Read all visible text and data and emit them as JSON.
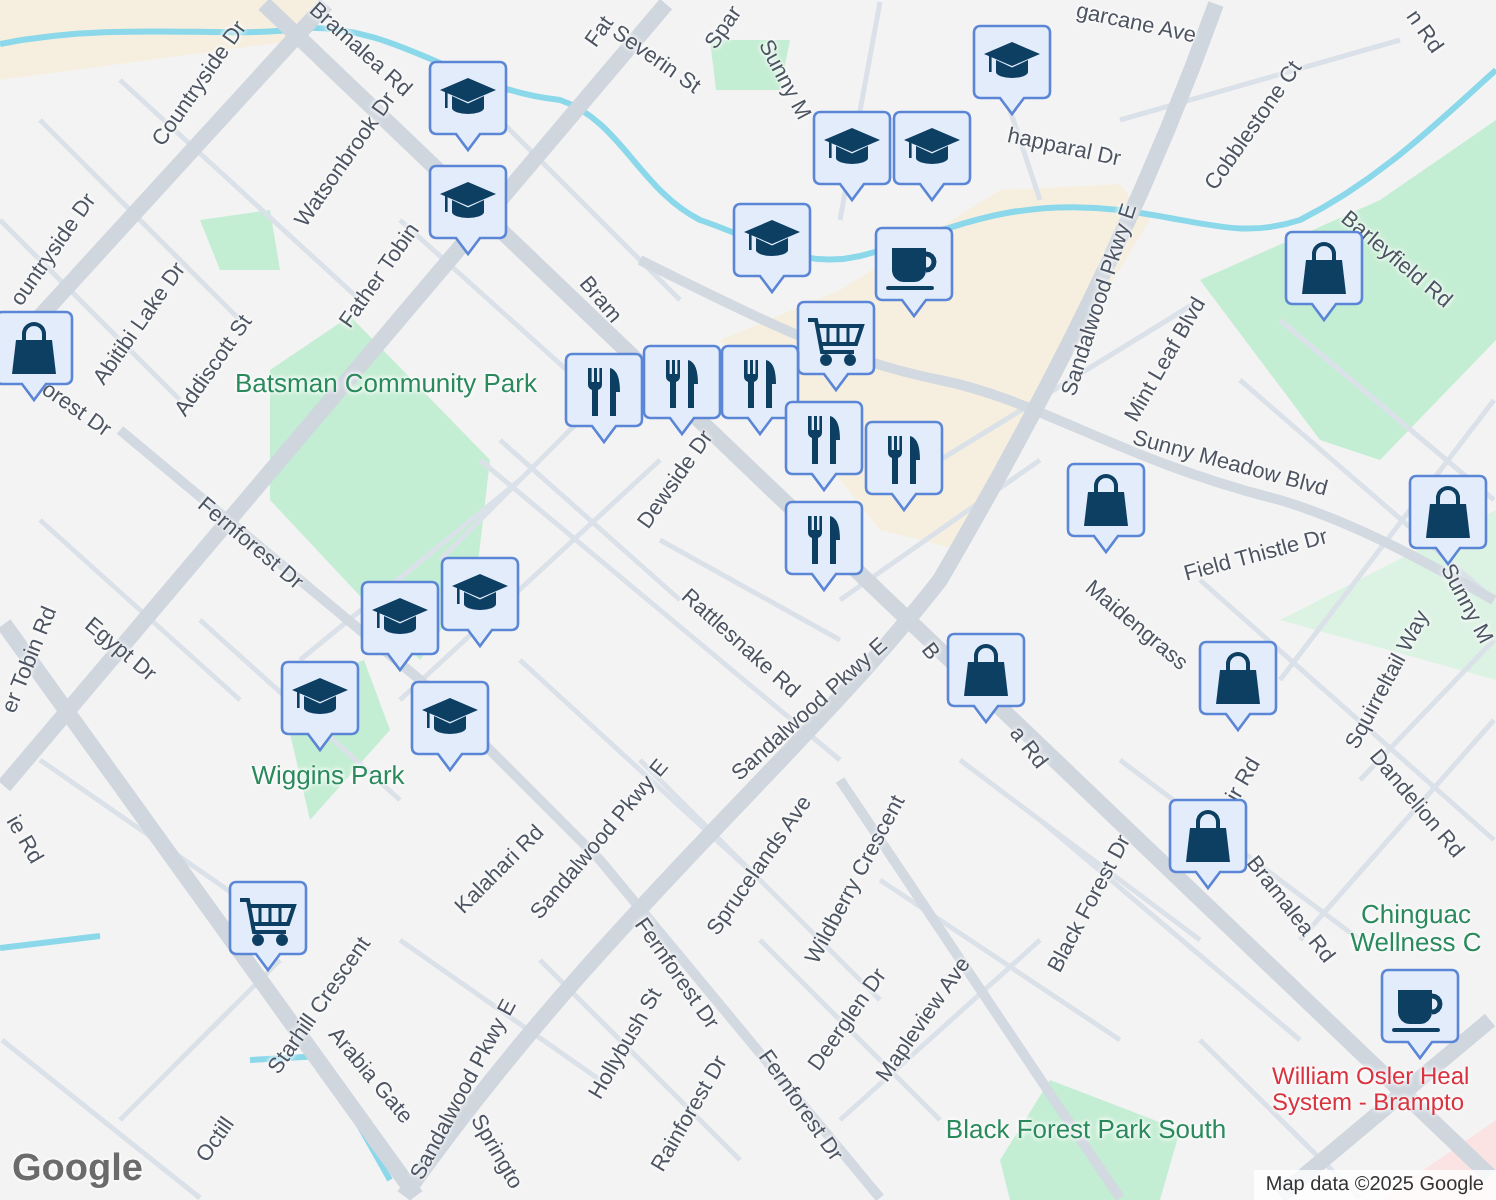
{
  "labels": [
    {
      "text": "Countryside Dr",
      "kind": "road"
    },
    {
      "text": "Bramalea Rd",
      "kind": "road"
    },
    {
      "text": "Fat",
      "kind": "road"
    },
    {
      "text": "Severin St",
      "kind": "road"
    },
    {
      "text": "Spar",
      "kind": "road"
    },
    {
      "text": "garcane Ave",
      "kind": "road"
    },
    {
      "text": "n Rd",
      "kind": "road"
    },
    {
      "text": "Sunny M",
      "kind": "road"
    },
    {
      "text": "happaral Dr",
      "kind": "road"
    },
    {
      "text": "Cobblestone Ct",
      "kind": "road"
    },
    {
      "text": "Sandalwood Pkwy E",
      "kind": "road"
    },
    {
      "text": "Barleyfield Rd",
      "kind": "road"
    },
    {
      "text": "Mint Leaf Blvd",
      "kind": "road"
    },
    {
      "text": "Sunny Meadow Blvd",
      "kind": "road"
    },
    {
      "text": "Field Thistle Dr",
      "kind": "road"
    },
    {
      "text": "Sunny M",
      "kind": "road"
    },
    {
      "text": "Watsonbrook Dr",
      "kind": "road"
    },
    {
      "text": "Abitibi Lake Dr",
      "kind": "road"
    },
    {
      "text": "Addiscott St",
      "kind": "road"
    },
    {
      "text": "Father Tobin",
      "kind": "road"
    },
    {
      "text": "ountryside Dr",
      "kind": "road"
    },
    {
      "text": "orest Dr",
      "kind": "road"
    },
    {
      "text": "Bram",
      "kind": "road"
    },
    {
      "text": "Batsman Community Park",
      "kind": "park"
    },
    {
      "text": "Dewside Dr",
      "kind": "road"
    },
    {
      "text": "Fernforest Dr",
      "kind": "road"
    },
    {
      "text": "Rattlesnake Rd",
      "kind": "road"
    },
    {
      "text": "Egypt Dr",
      "kind": "road"
    },
    {
      "text": "er Tobin Rd",
      "kind": "road"
    },
    {
      "text": "Wiggins Park",
      "kind": "park"
    },
    {
      "text": "Kalahari Rd",
      "kind": "road"
    },
    {
      "text": "ie Rd",
      "kind": "road"
    },
    {
      "text": "Sandalwood Pkwy E",
      "kind": "road"
    },
    {
      "text": "Sandalwood Pkwy E",
      "kind": "road"
    },
    {
      "text": "Sandalwood Pkwy E",
      "kind": "road"
    },
    {
      "text": "Fernforest Dr",
      "kind": "road"
    },
    {
      "text": "Sprucelands Ave",
      "kind": "road"
    },
    {
      "text": "Starhill Crescent",
      "kind": "road"
    },
    {
      "text": "Octill",
      "kind": "road"
    },
    {
      "text": "Arabia Gate",
      "kind": "road"
    },
    {
      "text": "Hollybush St",
      "kind": "road"
    },
    {
      "text": "Rainforest Dr",
      "kind": "road"
    },
    {
      "text": "Springto",
      "kind": "road"
    },
    {
      "text": "Fernforest Dr",
      "kind": "road"
    },
    {
      "text": "Wildberry Crescent",
      "kind": "road"
    },
    {
      "text": "Deerglen Dr",
      "kind": "road"
    },
    {
      "text": "Mapleview Ave",
      "kind": "road"
    },
    {
      "text": "Black Forest Dr",
      "kind": "road"
    },
    {
      "text": "Black Forest Park South",
      "kind": "park"
    },
    {
      "text": "Bramalea Rd",
      "kind": "road"
    },
    {
      "text": "B",
      "kind": "road"
    },
    {
      "text": "a Rd",
      "kind": "road"
    },
    {
      "text": "Maidengrass",
      "kind": "road"
    },
    {
      "text": "ir Rd",
      "kind": "road"
    },
    {
      "text": "Squirreltail Way",
      "kind": "road"
    },
    {
      "text": "Dandelion Rd",
      "kind": "road"
    },
    {
      "text": "Chinguac Wellness C",
      "kind": "park"
    },
    {
      "text": "William Osler Heal System - Brampto",
      "kind": "hospital"
    }
  ],
  "pins": [
    {
      "kind": "school"
    },
    {
      "kind": "school"
    },
    {
      "kind": "school"
    },
    {
      "kind": "school"
    },
    {
      "kind": "school"
    },
    {
      "kind": "school"
    },
    {
      "kind": "school"
    },
    {
      "kind": "school"
    },
    {
      "kind": "school"
    },
    {
      "kind": "school"
    },
    {
      "kind": "cart"
    },
    {
      "kind": "cart"
    },
    {
      "kind": "cafe"
    },
    {
      "kind": "cafe"
    },
    {
      "kind": "restaurant"
    },
    {
      "kind": "restaurant"
    },
    {
      "kind": "restaurant"
    },
    {
      "kind": "restaurant"
    },
    {
      "kind": "restaurant"
    },
    {
      "kind": "restaurant"
    },
    {
      "kind": "shopping"
    },
    {
      "kind": "shopping"
    },
    {
      "kind": "shopping"
    },
    {
      "kind": "shopping"
    },
    {
      "kind": "shopping"
    },
    {
      "kind": "shopping"
    },
    {
      "kind": "shopping"
    }
  ],
  "logo": "Google",
  "attribution": "Map data ©2025 Google"
}
